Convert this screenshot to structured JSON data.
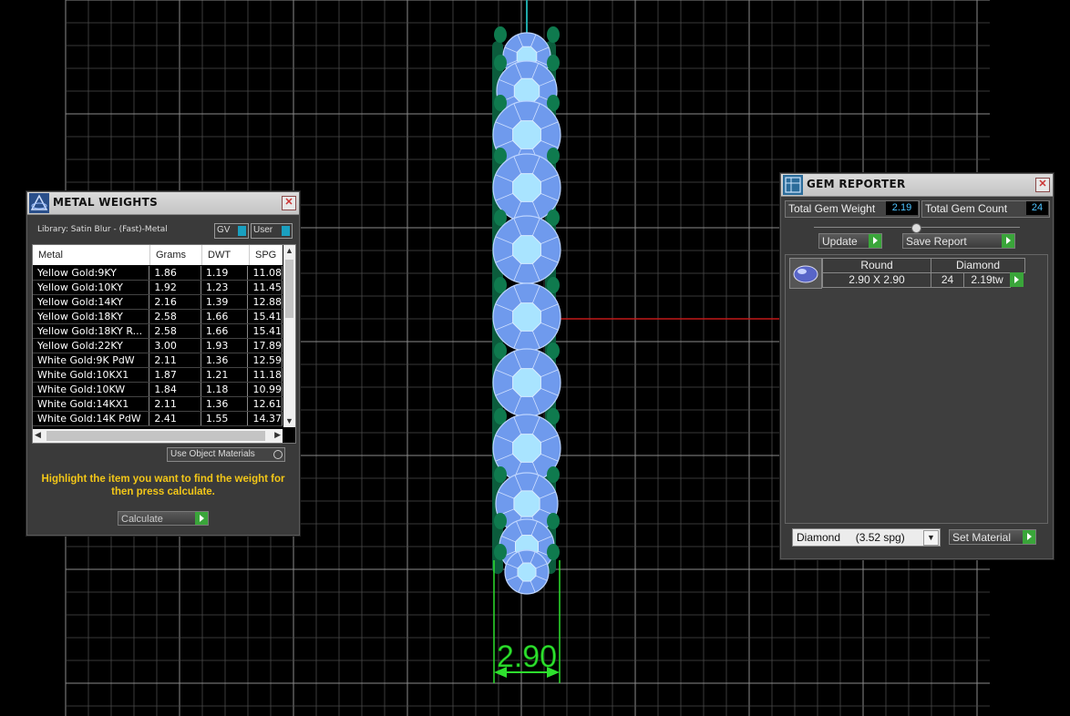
{
  "app": {
    "accent": "#2ee02e",
    "grid_color": "#7a7a7a"
  },
  "dimension": {
    "label": "2.90"
  },
  "metal_weights": {
    "title": "METAL WEIGHTS",
    "library_label": "Library: Satin Blur - (Fast)-Metal",
    "toggle_gv": "GV",
    "toggle_user": "User",
    "columns": [
      "Metal",
      "Grams",
      "DWT",
      "SPG"
    ],
    "rows": [
      [
        "Yellow Gold:9KY",
        "1.86",
        "1.19",
        "11.08"
      ],
      [
        "Yellow Gold:10KY",
        "1.92",
        "1.23",
        "11.45"
      ],
      [
        "Yellow Gold:14KY",
        "2.16",
        "1.39",
        "12.88"
      ],
      [
        "Yellow Gold:18KY",
        "2.58",
        "1.66",
        "15.41"
      ],
      [
        "Yellow Gold:18KY R...",
        "2.58",
        "1.66",
        "15.41"
      ],
      [
        "Yellow Gold:22KY",
        "3.00",
        "1.93",
        "17.89"
      ],
      [
        "White Gold:9K PdW",
        "2.11",
        "1.36",
        "12.59"
      ],
      [
        "White Gold:10KX1",
        "1.87",
        "1.21",
        "11.18"
      ],
      [
        "White Gold:10KW",
        "1.84",
        "1.18",
        "10.99"
      ],
      [
        "White Gold:14KX1",
        "2.11",
        "1.36",
        "12.61"
      ],
      [
        "White Gold:14K PdW",
        "2.41",
        "1.55",
        "14.37"
      ]
    ],
    "use_object_materials": "Use Object Materials",
    "hint": "Highlight the item you want to find the weight for then press calculate.",
    "calculate_label": "Calculate"
  },
  "gem_reporter": {
    "title": "GEM REPORTER",
    "total_weight_label": "Total Gem Weight",
    "total_weight_value": "2.19",
    "total_count_label": "Total Gem Count",
    "total_count_value": "24",
    "update_label": "Update",
    "save_report_label": "Save Report",
    "gem": {
      "shape": "Round",
      "material": "Diamond",
      "size": "2.90 X 2.90",
      "count": "24",
      "weight": "2.19tw"
    },
    "material_select": "Diamond     (3.52 spg)",
    "set_material_label": "Set Material"
  }
}
